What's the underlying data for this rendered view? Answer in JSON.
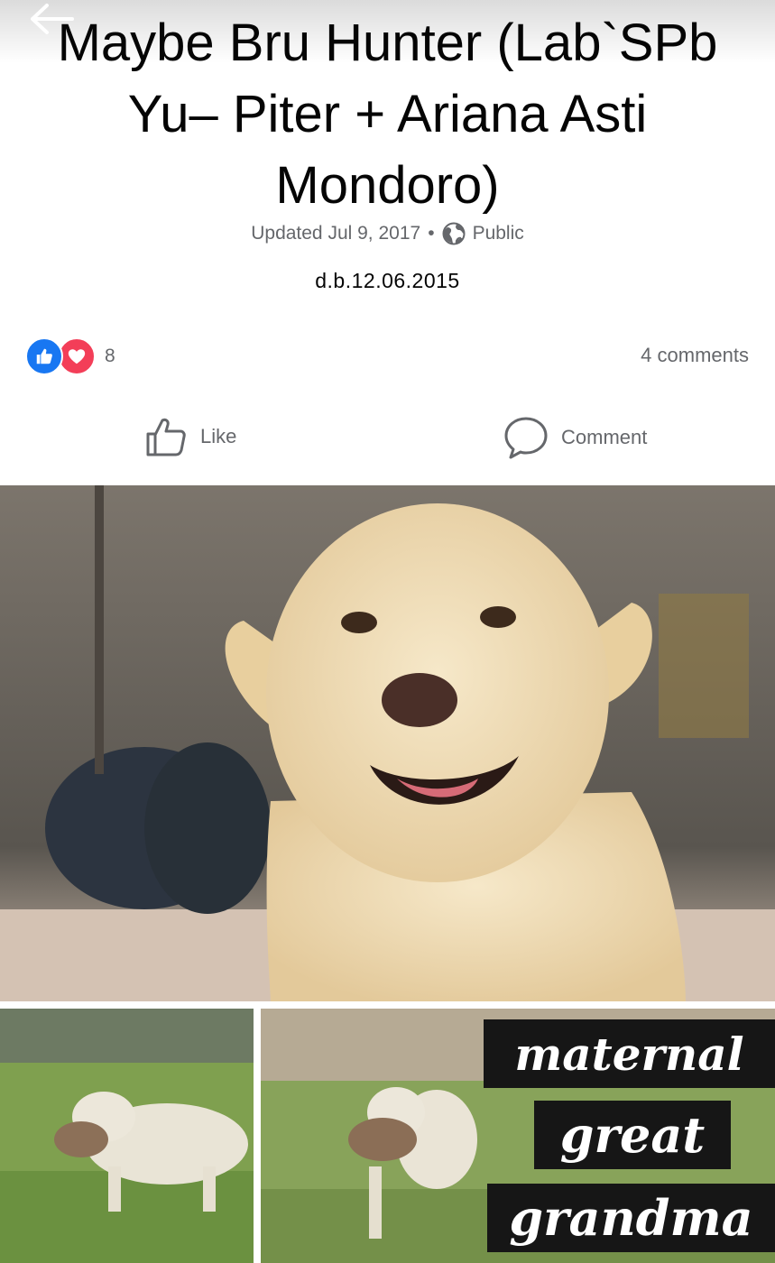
{
  "header": {
    "back_icon": "arrow-left-icon",
    "title": "Maybe Bru Hunter (Lab`SPb Yu– Piter + Ariana Asti Mondoro)"
  },
  "meta": {
    "updated": "Updated Jul 9, 2017",
    "separator": "•",
    "privacy_icon": "globe-icon",
    "privacy": "Public"
  },
  "description": "d.b.12.06.2015",
  "engagement": {
    "reaction_icons": [
      "like-reaction-icon",
      "love-reaction-icon"
    ],
    "reaction_count": "8",
    "comments": "4 comments"
  },
  "actions": {
    "like": "Like",
    "comment": "Comment"
  },
  "photos": {
    "overlay_lines": [
      "maternal",
      "great",
      "grandma"
    ]
  },
  "colors": {
    "accent_blue": "#1877f2",
    "love_red": "#f33e58",
    "secondary_text": "#65676b",
    "caption_bg": "#161616"
  }
}
